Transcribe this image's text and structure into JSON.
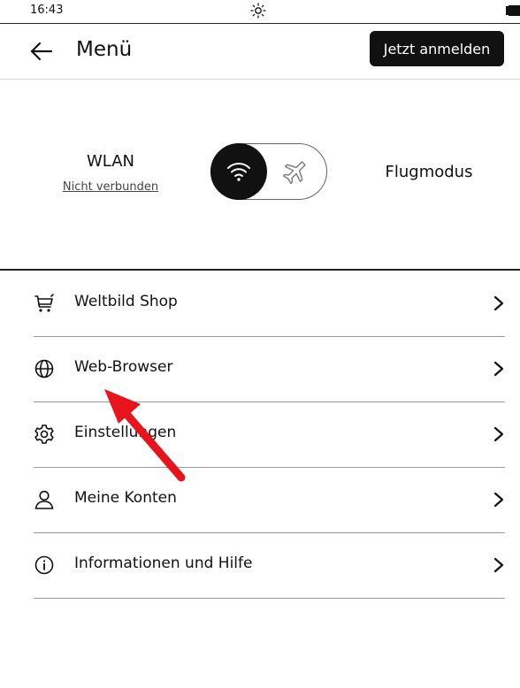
{
  "status": {
    "time": "16:43",
    "sun_icon": "brightness-icon",
    "battery_icon": "battery-icon"
  },
  "header": {
    "title": "Menü",
    "login_label": "Jetzt anmelden"
  },
  "connectivity": {
    "wlan_label": "WLAN",
    "wlan_status": "Nicht verbunden",
    "flight_label": "Flugmodus",
    "mode": "wlan"
  },
  "menu": [
    {
      "label": "Weltbild Shop",
      "icon": "cart-icon"
    },
    {
      "label": "Web-Browser",
      "icon": "globe-icon"
    },
    {
      "label": "Einstellungen",
      "icon": "gear-icon"
    },
    {
      "label": "Meine Konten",
      "icon": "user-icon"
    },
    {
      "label": "Informationen und Hilfe",
      "icon": "info-icon"
    }
  ],
  "annotation": {
    "color": "#e8141c"
  }
}
